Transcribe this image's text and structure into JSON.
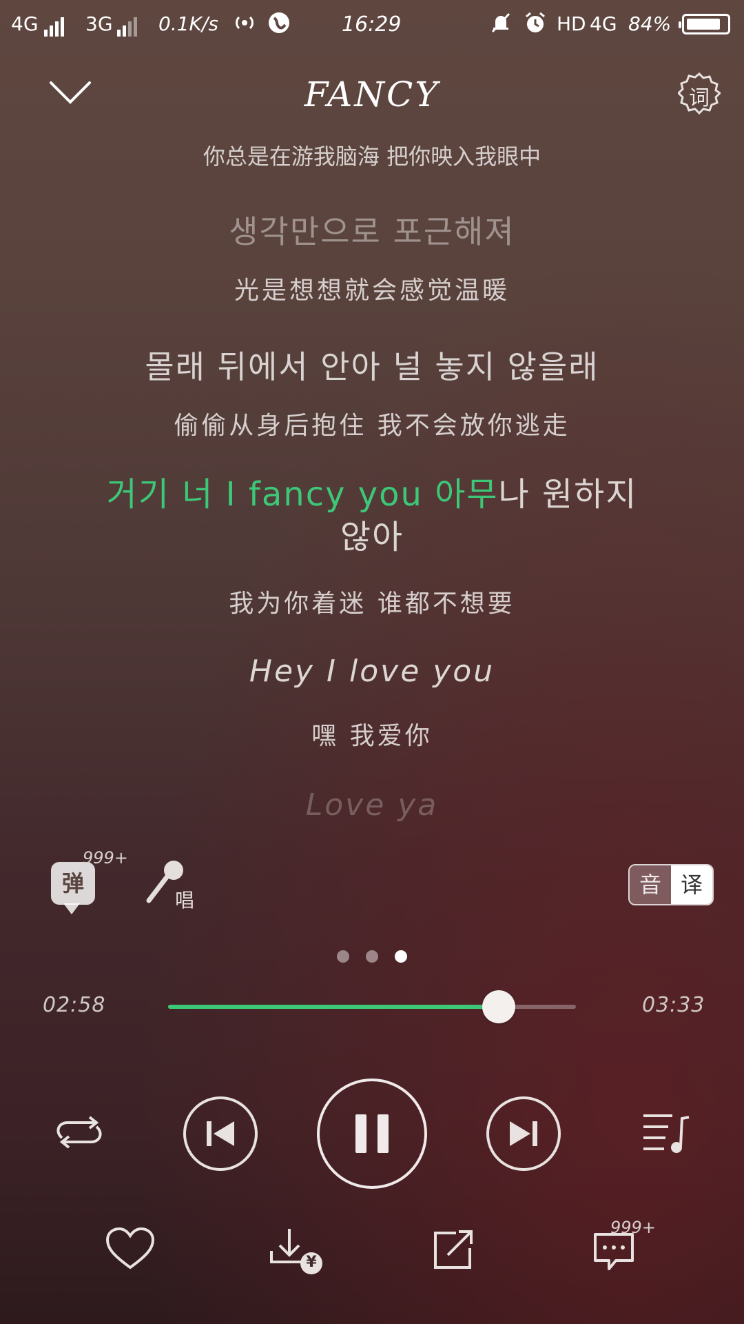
{
  "status_bar": {
    "network1": "4G",
    "network2": "3G",
    "speed": "0.1K/s",
    "time": "16:29",
    "hd": "HD",
    "network3": "4G",
    "battery": "84%"
  },
  "header": {
    "title": "FANCY",
    "lyrics_button_label": "词"
  },
  "lyrics": [
    {
      "text": "你总是在游我脑海  把你映入我眼中",
      "style": "zh very-faded"
    },
    {
      "text": "생각만으로 포근해져",
      "style": "ko faded"
    },
    {
      "text": "光是想想就会感觉温暖",
      "style": "zh"
    },
    {
      "text": "몰래 뒤에서 안아 널 놓지 않을래",
      "style": "ko"
    },
    {
      "text": "偷偷从身后抱住  我不会放你逃走",
      "style": "zh"
    },
    {
      "text": "我为你着迷  谁都不想要",
      "style": "zh"
    },
    {
      "text": "Hey I love you",
      "style": "en"
    },
    {
      "text": "嘿  我爱你",
      "style": "zh"
    },
    {
      "text": "Love ya",
      "style": "en very-faded"
    }
  ],
  "active_lyric": {
    "highlighted": "거기 너 I fancy you 아무",
    "rest_line1": "나 원하지",
    "rest_line2": "않아"
  },
  "tools": {
    "danmu_label": "弹",
    "danmu_count": "999+",
    "sing_label": "唱",
    "toggle_phonetic": "音",
    "toggle_translate": "译"
  },
  "pager": {
    "pages": 3,
    "current": 3
  },
  "progress": {
    "elapsed": "02:58",
    "total": "03:33",
    "fraction": 0.81
  },
  "actions": {
    "comment_count": "999+",
    "download_price_symbol": "¥"
  },
  "colors": {
    "accent": "#3dc878",
    "background_top": "#5f4740",
    "background_bottom": "#2d1a1d"
  }
}
